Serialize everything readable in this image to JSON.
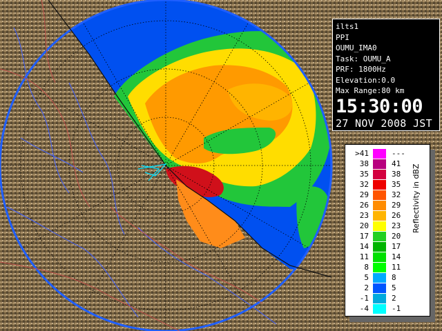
{
  "info": {
    "station": "ilts1",
    "scan_type": "PPI",
    "site_name": "OUMU_IMA0",
    "task": "Task: OUMU_A",
    "prf": "PRF: 1800Hz",
    "elevation": "Elevation:0.0",
    "max_range": "Max Range:80 km",
    "time": "15:30:00",
    "date": "27 NOV 2008 JST"
  },
  "legend": {
    "title": "Reflectivity in dBZ",
    "rows": [
      {
        "lo": ">41",
        "hi": "---",
        "color": "#ff00ff"
      },
      {
        "lo": "38",
        "hi": "41",
        "color": "#b8007f"
      },
      {
        "lo": "35",
        "hi": "38",
        "color": "#d3003f"
      },
      {
        "lo": "32",
        "hi": "35",
        "color": "#ee0000"
      },
      {
        "lo": "29",
        "hi": "32",
        "color": "#ff5500"
      },
      {
        "lo": "26",
        "hi": "29",
        "color": "#ff8c00"
      },
      {
        "lo": "23",
        "hi": "26",
        "color": "#ffb400"
      },
      {
        "lo": "20",
        "hi": "23",
        "color": "#ffff00"
      },
      {
        "lo": "17",
        "hi": "20",
        "color": "#22d022"
      },
      {
        "lo": "14",
        "hi": "17",
        "color": "#00b400"
      },
      {
        "lo": "11",
        "hi": "14",
        "color": "#00e000"
      },
      {
        "lo": "8",
        "hi": "11",
        "color": "#00ff00"
      },
      {
        "lo": "5",
        "hi": "8",
        "color": "#00aaff"
      },
      {
        "lo": "2",
        "hi": "5",
        "color": "#0055ff"
      },
      {
        "lo": "-1",
        "hi": "2",
        "color": "#00aadd"
      },
      {
        "lo": "-4",
        "hi": "-1",
        "color": "#00ffff"
      }
    ]
  },
  "colors": {
    "radar_background": "#0050f0",
    "coverage_edge": "#1f5fff",
    "coast_water": "#2858ff",
    "terrain": "#7a6448",
    "rivers": "#4060ff",
    "boundaries": "#c0504a"
  }
}
